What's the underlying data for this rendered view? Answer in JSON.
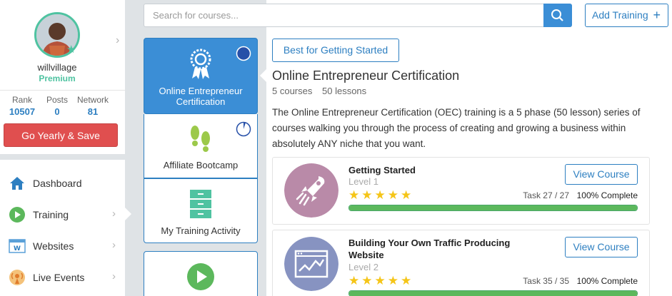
{
  "profile": {
    "username": "willvillage",
    "tier": "Premium",
    "stats": [
      {
        "label": "Rank",
        "value": "10507"
      },
      {
        "label": "Posts",
        "value": "0"
      },
      {
        "label": "Network",
        "value": "81"
      }
    ],
    "cta_label": "Go Yearly & Save"
  },
  "nav": {
    "items": [
      {
        "label": "Dashboard",
        "icon": "home-icon"
      },
      {
        "label": "Training",
        "icon": "play-circle-icon"
      },
      {
        "label": "Websites",
        "icon": "website-icon"
      },
      {
        "label": "Live Events",
        "icon": "broadcast-icon"
      }
    ]
  },
  "search": {
    "placeholder": "Search for courses...",
    "value": ""
  },
  "toolbar": {
    "add_training_label": "Add Training",
    "add_icon": "+"
  },
  "course_cards": [
    {
      "label": "Online Entrepreneur Certification",
      "icon": "award-ribbon-icon",
      "active": true,
      "progress": 1.0
    },
    {
      "label": "Affiliate Bootcamp",
      "icon": "footprints-icon",
      "active": false,
      "progress": 0.1
    },
    {
      "label": "My Training Activity",
      "icon": "file-cabinet-icon",
      "active": false
    },
    {
      "label": "",
      "icon": "play-circle-icon",
      "active": false
    }
  ],
  "course": {
    "tag_label": "Best for Getting Started",
    "title": "Online Entrepreneur Certification",
    "courses": "5 courses",
    "lessons": "50 lessons",
    "description": "The Online Entrepreneur Certification (OEC) training is a 5 phase (50 lesson) series of courses walking you through the process of creating and growing a business within absolutely ANY niche that you want."
  },
  "modules": [
    {
      "title": "Getting Started",
      "level": "Level 1",
      "stars": 5,
      "button_label": "View Course",
      "task": "Task 27 / 27",
      "complete": "100% Complete",
      "progress": 1.0,
      "icon": "rocket-icon",
      "icon_color": "#b98aa8"
    },
    {
      "title": "Building Your Own Traffic Producing Website",
      "level": "Level 2",
      "stars": 5,
      "button_label": "View Course",
      "task": "Task 35 / 35",
      "complete": "100% Complete",
      "progress": 1.0,
      "icon": "chart-window-icon",
      "icon_color": "#8793c1"
    }
  ],
  "colors": {
    "accent": "#2d7fc1",
    "cta": "#e04f4f",
    "premium": "#4fc3a1",
    "progress": "#5cb85c",
    "star": "#f5c518"
  }
}
